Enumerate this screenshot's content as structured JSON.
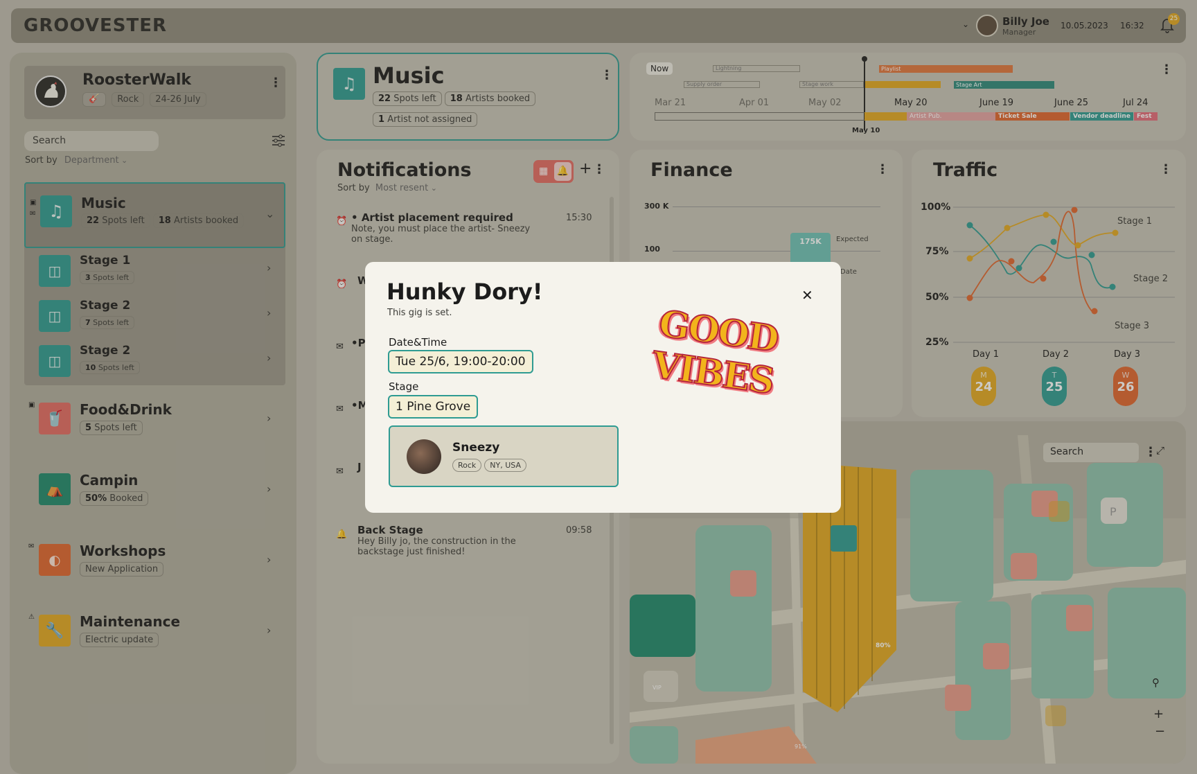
{
  "app": {
    "logo": "GROOVESTER"
  },
  "header": {
    "user_name": "Billy Joe",
    "user_role": "Manager",
    "date": "10.05.2023",
    "time": "16:32",
    "notif_count": "25"
  },
  "sidebar": {
    "event": {
      "name": "RoosterWalk",
      "genre": "Rock",
      "dates": "24-26 July"
    },
    "search_placeholder": "Search",
    "sort_label": "Sort by",
    "sort_value": "Department",
    "music": {
      "title": "Music",
      "spots_num": "22",
      "spots": "Spots left",
      "artists_num": "18",
      "artists": "Artists booked"
    },
    "stages": [
      {
        "title": "Stage 1",
        "num": "3",
        "text": "Spots left"
      },
      {
        "title": "Stage 2",
        "num": "7",
        "text": "Spots left"
      },
      {
        "title": "Stage 2",
        "num": "10",
        "text": "Spots left"
      }
    ],
    "depts": [
      {
        "title": "Food&Drink",
        "num": "5",
        "text": "Spots left"
      },
      {
        "title": "Campin",
        "num": "50%",
        "text": "Booked"
      },
      {
        "title": "Workshops",
        "num": "",
        "text": "New Application"
      },
      {
        "title": "Maintenance",
        "num": "",
        "text": "Electric update"
      }
    ]
  },
  "music_card": {
    "title": "Music",
    "spots_num": "22",
    "spots": "Spots left",
    "artists_num": "18",
    "artists": "Artists booked",
    "unassigned_num": "1",
    "unassigned": "Artist not assigned"
  },
  "timeline": {
    "now": "Now",
    "bars": [
      "Lightning",
      "Playlist",
      "Supply order",
      "Stage work",
      "Stage Art"
    ],
    "months": [
      "Mar 21",
      "Apr 01",
      "May 02",
      "May 20",
      "June 19",
      "June 25",
      "Jul 24"
    ],
    "phases": [
      "Artist Pub.",
      "Ticket Sale",
      "Vendor deadline",
      "Fest"
    ],
    "marker": "May 10"
  },
  "notifications": {
    "title": "Notifications",
    "sort_label": "Sort by",
    "sort_value": "Most resent",
    "first": {
      "title": "Artist placement required",
      "body": "Note, you must place the artist- Sneezy on stage.",
      "time": "15:30"
    },
    "partials": [
      "W",
      "P",
      "M",
      "J"
    ],
    "last": {
      "title": "Back Stage",
      "body": "Hey Billy jo, the construction in the backstage just finished!",
      "time": "09:58"
    }
  },
  "finance": {
    "title": "Finance",
    "y_top": "300",
    "unit": "K",
    "y_mid": "100",
    "bar_label": "175K",
    "expected": "Expected",
    "to_date": "Date"
  },
  "traffic": {
    "title": "Traffic",
    "y_labels": [
      "100%",
      "75%",
      "50%",
      "25%"
    ],
    "days": [
      {
        "label": "Day 1",
        "dow": "M",
        "num": "24",
        "color": "#e2a822"
      },
      {
        "label": "Day 2",
        "dow": "T",
        "num": "25",
        "color": "#2e9b92"
      },
      {
        "label": "Day 3",
        "dow": "W",
        "num": "26",
        "color": "#e0662e"
      }
    ],
    "series": [
      "Stage 1",
      "Stage 2",
      "Stage 3"
    ]
  },
  "map": {
    "search_placeholder": "Search",
    "parking": "P",
    "pct1": "80%",
    "pct2": "91%",
    "vip": "VIP"
  },
  "modal": {
    "title": "Hunky Dory!",
    "subtitle": "This gig is set.",
    "datetime_label": "Date&Time",
    "datetime_value": "Tue 25/6, 19:00-20:00",
    "stage_label": "Stage",
    "stage_value": "1 Pine Grove",
    "artist": {
      "name": "Sneezy",
      "genre": "Rock",
      "location": "NY, USA"
    },
    "sticker_line1": "GOOD",
    "sticker_line2": "VIBES"
  }
}
